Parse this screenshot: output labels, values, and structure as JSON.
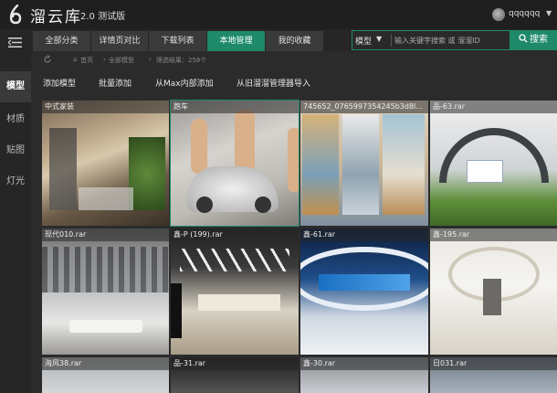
{
  "app": {
    "name": "溜云库",
    "version": "2.0 测试版",
    "username": "qqqqqq"
  },
  "rail": {
    "items": [
      {
        "label": "模型"
      },
      {
        "label": "材质"
      },
      {
        "label": "贴图"
      },
      {
        "label": "灯光"
      }
    ]
  },
  "nav": {
    "tabs": [
      {
        "label": "全部分类"
      },
      {
        "label": "详情页对比"
      },
      {
        "label": "下载列表"
      },
      {
        "label": "本地管理"
      },
      {
        "label": "我的收藏"
      }
    ]
  },
  "search": {
    "category": "模型",
    "placeholder": "输入关键字搜索 或 溜溜ID",
    "button": "搜索"
  },
  "breadcrumb": {
    "home": "首页",
    "section": "全部模型",
    "result": "筛选结果：258个"
  },
  "actions": {
    "add_model": "添加模型",
    "batch_add": "批量添加",
    "from_max": "从Max内部添加",
    "import_old": "从旧溜溜管理器导入"
  },
  "grid": {
    "tiles": [
      {
        "label": "中式家装"
      },
      {
        "label": "跑车"
      },
      {
        "label": "745652_0765997354245b3d8l..."
      },
      {
        "label": "品-63.rar"
      },
      {
        "label": "现代010.rar"
      },
      {
        "label": "鑫-P (199).rar"
      },
      {
        "label": "鑫-61.rar"
      },
      {
        "label": "鑫-195.rar"
      },
      {
        "label": "海风38.rar"
      },
      {
        "label": "品-31.rar"
      },
      {
        "label": "鑫-30.rar"
      },
      {
        "label": "日031.rar"
      }
    ]
  },
  "colors": {
    "accent": "#1e8a6a",
    "topbar": "#1f1f1f",
    "background": "#2b2b2b"
  }
}
